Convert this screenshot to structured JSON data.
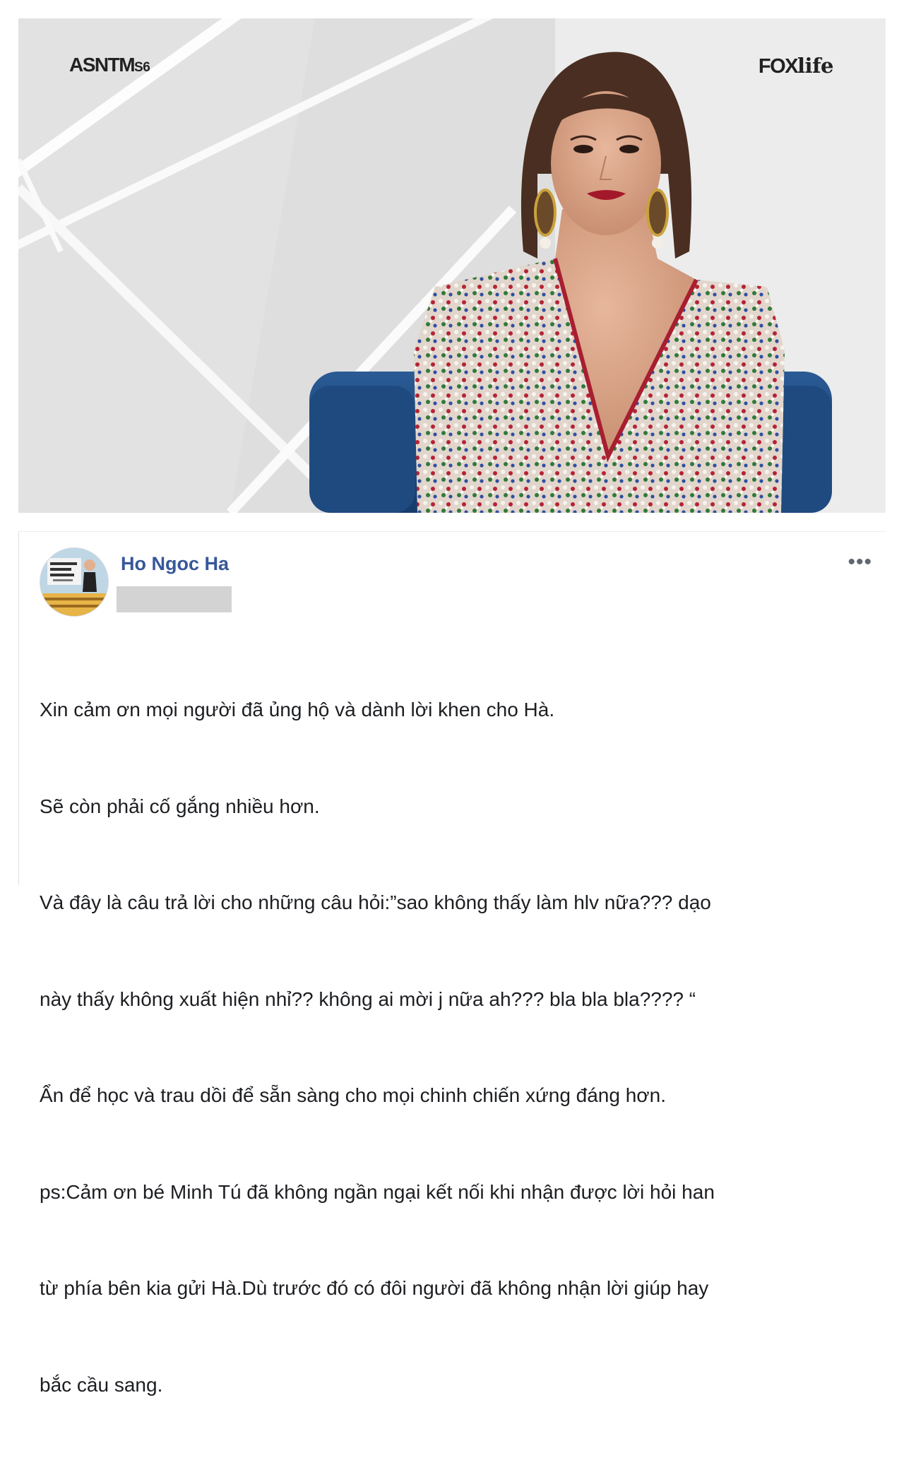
{
  "photo": {
    "logo_left_main": "ASNTM",
    "logo_left_sub": "S6",
    "logo_right_brand": "FOX",
    "logo_right_sub": "life"
  },
  "post": {
    "author": "Ho Ngoc Ha",
    "more_icon": "•••",
    "lines": [
      "Xin cảm ơn mọi người đã ủng hộ và dành lời khen cho Hà.",
      "Sẽ còn phải cố gắng nhiều hơn.",
      "Và đây là câu trả lời cho những câu hỏi:”sao không thấy làm hlv nữa??? dạo",
      "này thấy không xuất hiện nhỉ?? không ai mời j nữa ah??? bla bla bla???? “",
      "Ẩn để học và trau dồi để sẵn sàng cho mọi chinh chiến xứng đáng hơn.",
      "ps:Cảm ơn bé Minh Tú đã không ngần ngại kết nối khi nhận được lời hỏi han",
      "từ phía bên kia gửi Hà.Dù trước đó có đôi người đã không nhận lời giúp hay",
      "bắc cầu sang."
    ]
  },
  "colors": {
    "author_link": "#365899",
    "text": "#1c1e21",
    "sofa_blue": "#1d4a82"
  }
}
